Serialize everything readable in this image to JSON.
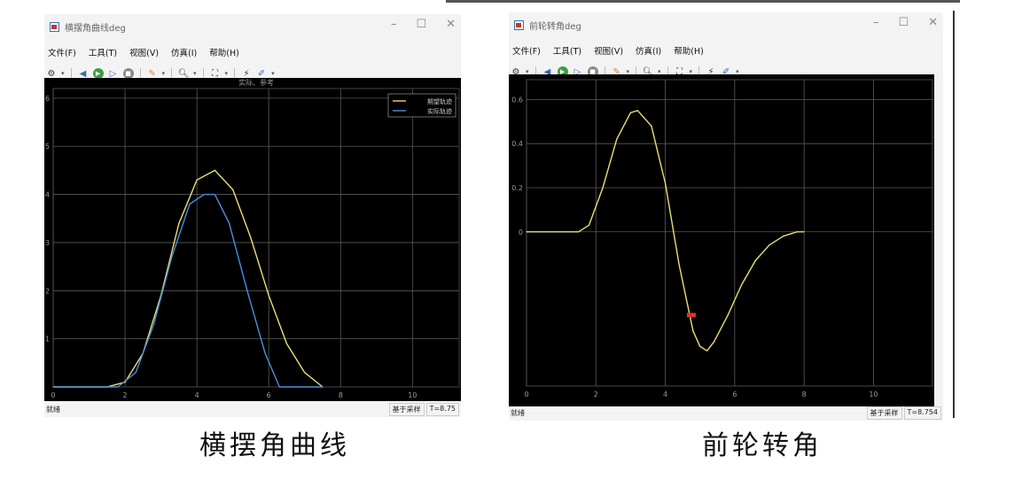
{
  "left": {
    "title": "横摆角曲线deg",
    "menu": [
      "文件(F)",
      "工具(T)",
      "视图(V)",
      "仿真(I)",
      "帮助(H)"
    ],
    "plot_title": "实际、参考",
    "legend": [
      "期望轨迹",
      "实际轨迹"
    ],
    "status_left": "就绪",
    "status_mode": "基于采样",
    "status_time": "T=8.75",
    "caption": "横摆角曲线"
  },
  "right": {
    "title": "前轮转角deg",
    "menu": [
      "文件(F)",
      "工具(T)",
      "视图(V)",
      "仿真(I)",
      "帮助(H)"
    ],
    "status_left": "就绪",
    "status_mode": "基于采样",
    "status_time": "T=8.754",
    "caption": "前轮转角"
  },
  "colors": {
    "yellow": "#e8e070",
    "blue": "#4a8fe0",
    "grid": "#5a5a5a",
    "tick": "#9a9a9a",
    "red_marker": "#e03030"
  },
  "chart_data": [
    {
      "type": "line",
      "title": "实际、参考",
      "xlim": [
        0,
        11.3
      ],
      "ylim": [
        0,
        6.2
      ],
      "xticks": [
        0,
        2,
        4,
        6,
        8,
        10
      ],
      "yticks": [
        1,
        2,
        3,
        4,
        5,
        6
      ],
      "series": [
        {
          "name": "期望轨迹",
          "x": [
            0,
            1.5,
            2,
            2.5,
            3,
            3.5,
            4,
            4.5,
            5,
            5.5,
            6,
            6.5,
            7,
            7.5
          ],
          "y": [
            0,
            0,
            0.1,
            0.7,
            1.9,
            3.4,
            4.3,
            4.5,
            4.1,
            3.1,
            1.9,
            0.9,
            0.3,
            0
          ]
        },
        {
          "name": "实际轨迹",
          "x": [
            0,
            1.8,
            2.3,
            2.8,
            3.3,
            3.8,
            4.2,
            4.5,
            4.9,
            5.4,
            5.9,
            6.3,
            7.5
          ],
          "y": [
            0,
            0,
            0.3,
            1.3,
            2.7,
            3.8,
            4.0,
            4.0,
            3.4,
            2.0,
            0.7,
            0,
            0
          ]
        }
      ]
    },
    {
      "type": "line",
      "xlim": [
        0,
        11.7
      ],
      "ylim": [
        -0.7,
        0.69
      ],
      "xticks": [
        0,
        2,
        4,
        6,
        8,
        10
      ],
      "yticks": [
        0,
        0.2,
        0.4,
        0.6
      ],
      "series": [
        {
          "x": [
            0,
            1.5,
            1.8,
            2.2,
            2.6,
            3.0,
            3.2,
            3.6,
            4.0,
            4.4,
            4.8,
            5.0,
            5.2,
            5.4,
            5.8,
            6.2,
            6.6,
            7.0,
            7.4,
            7.8,
            8.0
          ],
          "y": [
            0,
            0,
            0.03,
            0.2,
            0.42,
            0.54,
            0.55,
            0.48,
            0.22,
            -0.15,
            -0.45,
            -0.52,
            -0.54,
            -0.5,
            -0.38,
            -0.24,
            -0.13,
            -0.06,
            -0.02,
            0,
            0
          ]
        }
      ],
      "marker": {
        "x": 4.75,
        "y": -0.38
      }
    }
  ]
}
